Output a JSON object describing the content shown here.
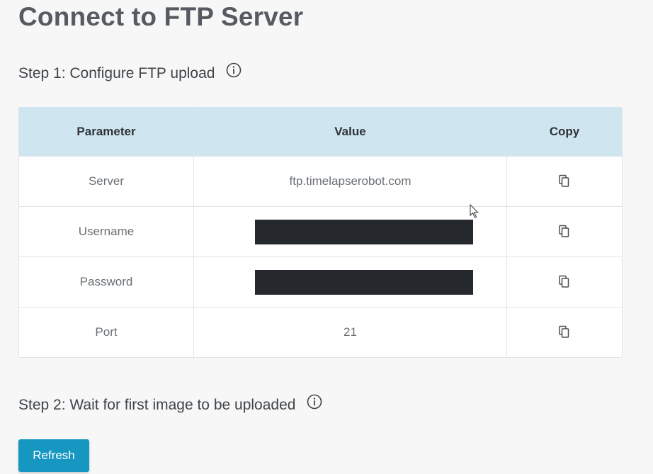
{
  "page": {
    "title": "Connect to FTP Server"
  },
  "step1": {
    "heading": "Step 1: Configure FTP upload",
    "icon": "info-icon"
  },
  "table": {
    "headers": [
      "Parameter",
      "Value",
      "Copy"
    ],
    "rows": [
      {
        "parameter": "Server",
        "value": "ftp.timelapserobot.com",
        "redacted": false
      },
      {
        "parameter": "Username",
        "value": "",
        "redacted": true
      },
      {
        "parameter": "Password",
        "value": "",
        "redacted": true
      },
      {
        "parameter": "Port",
        "value": "21",
        "redacted": false
      }
    ],
    "copy_icon": "copy-icon"
  },
  "step2": {
    "heading": "Step 2: Wait for first image to be uploaded",
    "icon": "info-icon"
  },
  "actions": {
    "refresh_label": "Refresh"
  },
  "colors": {
    "header_bg": "#cfe6f0",
    "button_bg": "#1597c2",
    "redaction": "#25282c"
  }
}
